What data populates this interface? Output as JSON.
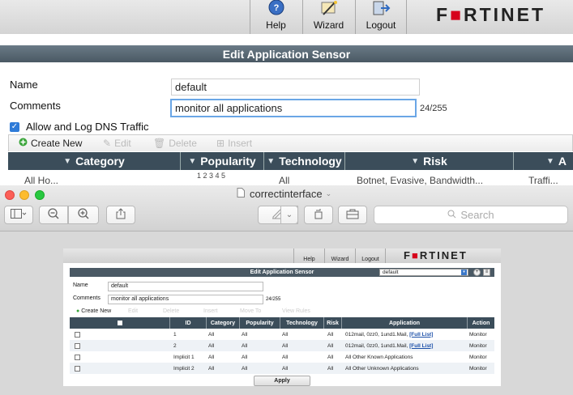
{
  "fortinet": {
    "toolbar": {
      "help_label": "Help",
      "wizard_label": "Wizard",
      "logout_label": "Logout"
    },
    "logo": {
      "part1": "F",
      "red": "■",
      "part2": "RTINET"
    },
    "panel_title": "Edit Application Sensor",
    "form": {
      "name_label": "Name",
      "name_value": "default",
      "comments_label": "Comments",
      "comments_value": "monitor all applications",
      "comments_count": "24/255",
      "dns_label": "Allow and Log DNS Traffic"
    },
    "list_toolbar": {
      "create_new": "Create New",
      "edit": "Edit",
      "delete": "Delete",
      "insert": "Insert"
    },
    "columns": [
      "Category",
      "Popularity",
      "Technology",
      "Risk",
      "A"
    ],
    "partial_row": {
      "category": "All Ho...",
      "popularity": "1 2 3 4 5",
      "technology": "All",
      "risk": "Botnet, Evasive, Bandwidth...",
      "application": "Traffi..."
    },
    "colors": {
      "header": "#3b4d5a",
      "titlebar": "#4a5964",
      "logo_red": "#d6001c"
    }
  },
  "preview": {
    "window_title": "correctinterface",
    "search_placeholder": "Search",
    "embedded": {
      "toolbar": {
        "help": "Help",
        "wizard": "Wizard",
        "logout": "Logout"
      },
      "logo": {
        "part1": "F",
        "red": "■",
        "part2": "RTINET"
      },
      "panel_title": "Edit Application Sensor",
      "sensor_select": "default",
      "name_label": "Name",
      "name_value": "default",
      "comments_label": "Comments",
      "comments_value": "monitor all applications",
      "comments_count": "24/255",
      "list_toolbar": {
        "create_new": "Create New",
        "edit": "Edit",
        "delete": "Delete",
        "insert": "Insert",
        "move_to": "Move To",
        "view_rules": "View Rules"
      },
      "columns": [
        "",
        "ID",
        "Category",
        "Popularity",
        "Technology",
        "Risk",
        "Application",
        "Action"
      ],
      "rows": [
        {
          "id": "1",
          "category": "All",
          "popularity": "All",
          "technology": "All",
          "risk": "All",
          "application": "012mail, 0zz0, 1und1.Mail,",
          "link": "[Full List]",
          "action": "Monitor"
        },
        {
          "id": "2",
          "category": "All",
          "popularity": "All",
          "technology": "All",
          "risk": "All",
          "application": "012mail, 0zz0, 1und1.Mail,",
          "link": "[Full List]",
          "action": "Monitor"
        },
        {
          "id": "Implicit 1",
          "category": "All",
          "popularity": "All",
          "technology": "All",
          "risk": "All",
          "application": "All Other Known Applications",
          "link": "",
          "action": "Monitor"
        },
        {
          "id": "Implicit 2",
          "category": "All",
          "popularity": "All",
          "technology": "All",
          "risk": "All",
          "application": "All Other Unknown Applications",
          "link": "",
          "action": "Monitor"
        }
      ],
      "apply_label": "Apply"
    }
  }
}
